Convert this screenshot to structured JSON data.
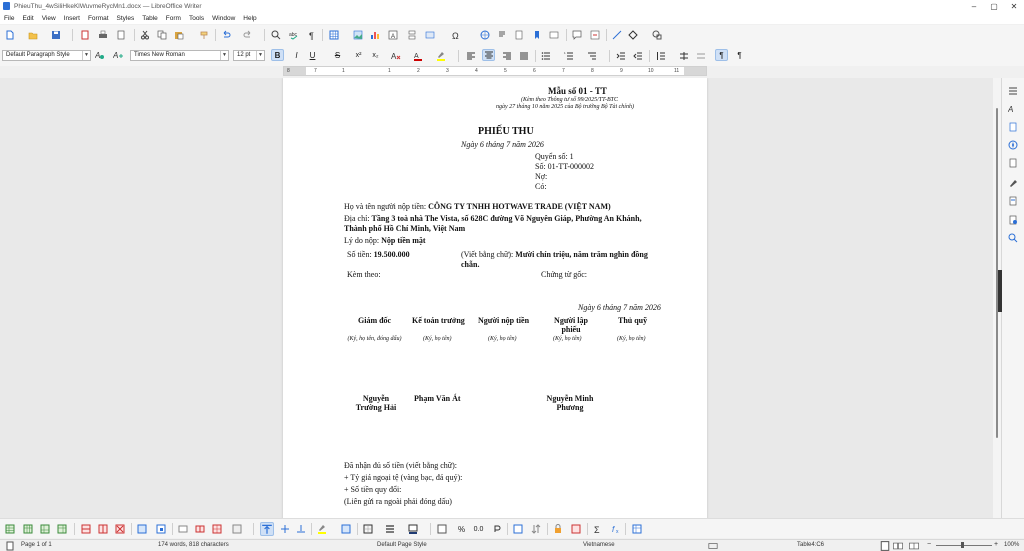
{
  "window": {
    "title": "PhieuThu_4wSiliHkeKlWuvmeRycMn1.docx — LibreOffice Writer"
  },
  "menu": [
    "File",
    "Edit",
    "View",
    "Insert",
    "Format",
    "Styles",
    "Table",
    "Form",
    "Tools",
    "Window",
    "Help"
  ],
  "formatting": {
    "paragraph_style": "Default Paragraph Style",
    "font_name": "Times New Roman",
    "font_size": "12 pt"
  },
  "ruler": [
    "8",
    "7",
    "1",
    "1",
    "2",
    "3",
    "4",
    "5",
    "6",
    "7",
    "8",
    "9",
    "10",
    "11"
  ],
  "doc": {
    "form_no": "Mẫu số 01 - TT",
    "attached_note": "(Kèm theo Thông tư số 99/2025/TT-BTC",
    "date_note": "ngày 27 tháng 10 năm 2025 của Bộ trưởng Bộ Tài chính)",
    "title": "PHIẾU THU",
    "date": "Ngày 6 tháng 7 năm 2026",
    "book_no": "Quyển số: 1",
    "number": "Số: 01-TT-000002",
    "debit": "Nợ:",
    "credit": "Có:",
    "payer_label": "Họ và tên người nộp tiền: ",
    "payer_value": "CÔNG TY TNHH HOTWAVE TRADE (VIỆT NAM)",
    "address_label": "Địa chỉ: ",
    "address_line1": "Tầng 3 toà nhà The Vista, số 628C đường Võ Nguyên Giáp, Phường An Khánh,",
    "address_line2": "Thành phố Hồ Chí Minh, Việt Nam",
    "reason_label": "Lý do nộp: ",
    "reason_value": "Nộp tiền mặt",
    "amount_label": "Số tiền: ",
    "amount_value": "19.500.000",
    "words_label": "(Viết bằng chữ): ",
    "words_value1": "Mười chín triệu, năm trăm nghìn đồng",
    "words_value2": "chẵn.",
    "attached": "Kèm theo:",
    "original_docs": "Chứng từ gốc:",
    "sign_date": "Ngày 6 tháng 7 năm 2026",
    "sig_titles": [
      "Giám đốc",
      "Kế toán trưởng",
      "Người nộp tiền",
      "Người lập phiếu",
      "Thủ quỹ"
    ],
    "sig_notes": [
      "(Ký, họ tên, đóng dấu)",
      "(Ký, họ tên)",
      "(Ký, họ tên)",
      "(Ký, họ tên)",
      "(Ký, họ tên)"
    ],
    "sig_names": [
      "Nguyễn Trường Hải",
      "Phạm Văn Át",
      "",
      "Nguyễn Minh Phương",
      ""
    ],
    "received_words": "Đã nhận đủ số tiền (viết bằng chữ):",
    "fx_rate": "+ Tỷ giá ngoại tệ (vàng bạc, đá quý):",
    "converted": "+ Số tiền quy đổi:",
    "copy_note": "(Liên gửi ra ngoài phải đóng dấu)"
  },
  "status": {
    "page": "Page 1 of 1",
    "words": "174 words, 818 characters",
    "page_style": "Default Page Style",
    "language": "Vietnamese",
    "cell": "Table4:C6",
    "zoom": "100%"
  }
}
